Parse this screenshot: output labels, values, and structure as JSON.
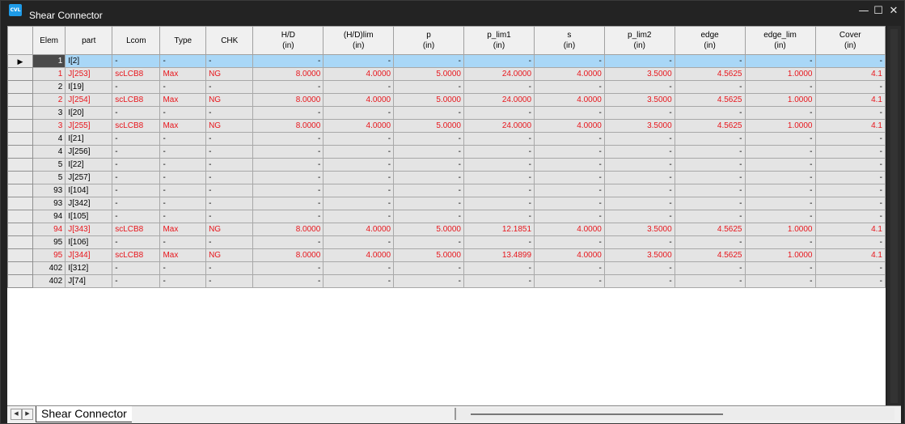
{
  "window": {
    "title": "Shear Connector",
    "icon_text": "CVL"
  },
  "controls": {
    "minimize": "—",
    "maximize": "☐",
    "close": "✕"
  },
  "columns": [
    {
      "line1": "",
      "line2": ""
    },
    {
      "line1": "Elem",
      "line2": ""
    },
    {
      "line1": "part",
      "line2": ""
    },
    {
      "line1": "Lcom",
      "line2": ""
    },
    {
      "line1": "Type",
      "line2": ""
    },
    {
      "line1": "CHK",
      "line2": ""
    },
    {
      "line1": "H/D",
      "line2": "(in)"
    },
    {
      "line1": "(H/D)lim",
      "line2": "(in)"
    },
    {
      "line1": "p",
      "line2": "(in)"
    },
    {
      "line1": "p_lim1",
      "line2": "(in)"
    },
    {
      "line1": "s",
      "line2": "(in)"
    },
    {
      "line1": "p_lim2",
      "line2": "(in)"
    },
    {
      "line1": "edge",
      "line2": "(in)"
    },
    {
      "line1": "edge_lim",
      "line2": "(in)"
    },
    {
      "line1": "Cover",
      "line2": "(in)"
    }
  ],
  "rows": [
    {
      "ind": "▶",
      "ng": false,
      "sel": true,
      "cells": [
        "1",
        "I[2]",
        "-",
        "-",
        "-",
        "-",
        "-",
        "-",
        "-",
        "-",
        "-",
        "-",
        "-",
        "-"
      ]
    },
    {
      "ind": "",
      "ng": true,
      "sel": false,
      "cells": [
        "1",
        "J[253]",
        "scLCB8",
        "Max",
        "NG",
        "8.0000",
        "4.0000",
        "5.0000",
        "24.0000",
        "4.0000",
        "3.5000",
        "4.5625",
        "1.0000",
        "4.1"
      ]
    },
    {
      "ind": "",
      "ng": false,
      "sel": false,
      "cells": [
        "2",
        "I[19]",
        "-",
        "-",
        "-",
        "-",
        "-",
        "-",
        "-",
        "-",
        "-",
        "-",
        "-",
        "-"
      ]
    },
    {
      "ind": "",
      "ng": true,
      "sel": false,
      "cells": [
        "2",
        "J[254]",
        "scLCB8",
        "Max",
        "NG",
        "8.0000",
        "4.0000",
        "5.0000",
        "24.0000",
        "4.0000",
        "3.5000",
        "4.5625",
        "1.0000",
        "4.1"
      ]
    },
    {
      "ind": "",
      "ng": false,
      "sel": false,
      "cells": [
        "3",
        "I[20]",
        "-",
        "-",
        "-",
        "-",
        "-",
        "-",
        "-",
        "-",
        "-",
        "-",
        "-",
        "-"
      ]
    },
    {
      "ind": "",
      "ng": true,
      "sel": false,
      "cells": [
        "3",
        "J[255]",
        "scLCB8",
        "Max",
        "NG",
        "8.0000",
        "4.0000",
        "5.0000",
        "24.0000",
        "4.0000",
        "3.5000",
        "4.5625",
        "1.0000",
        "4.1"
      ]
    },
    {
      "ind": "",
      "ng": false,
      "sel": false,
      "cells": [
        "4",
        "I[21]",
        "-",
        "-",
        "-",
        "-",
        "-",
        "-",
        "-",
        "-",
        "-",
        "-",
        "-",
        "-"
      ]
    },
    {
      "ind": "",
      "ng": false,
      "sel": false,
      "cells": [
        "4",
        "J[256]",
        "-",
        "-",
        "-",
        "-",
        "-",
        "-",
        "-",
        "-",
        "-",
        "-",
        "-",
        "-"
      ]
    },
    {
      "ind": "",
      "ng": false,
      "sel": false,
      "cells": [
        "5",
        "I[22]",
        "-",
        "-",
        "-",
        "-",
        "-",
        "-",
        "-",
        "-",
        "-",
        "-",
        "-",
        "-"
      ]
    },
    {
      "ind": "",
      "ng": false,
      "sel": false,
      "cells": [
        "5",
        "J[257]",
        "-",
        "-",
        "-",
        "-",
        "-",
        "-",
        "-",
        "-",
        "-",
        "-",
        "-",
        "-"
      ]
    },
    {
      "ind": "",
      "ng": false,
      "sel": false,
      "cells": [
        "93",
        "I[104]",
        "-",
        "-",
        "-",
        "-",
        "-",
        "-",
        "-",
        "-",
        "-",
        "-",
        "-",
        "-"
      ]
    },
    {
      "ind": "",
      "ng": false,
      "sel": false,
      "cells": [
        "93",
        "J[342]",
        "-",
        "-",
        "-",
        "-",
        "-",
        "-",
        "-",
        "-",
        "-",
        "-",
        "-",
        "-"
      ]
    },
    {
      "ind": "",
      "ng": false,
      "sel": false,
      "cells": [
        "94",
        "I[105]",
        "-",
        "-",
        "-",
        "-",
        "-",
        "-",
        "-",
        "-",
        "-",
        "-",
        "-",
        "-"
      ]
    },
    {
      "ind": "",
      "ng": true,
      "sel": false,
      "cells": [
        "94",
        "J[343]",
        "scLCB8",
        "Max",
        "NG",
        "8.0000",
        "4.0000",
        "5.0000",
        "12.1851",
        "4.0000",
        "3.5000",
        "4.5625",
        "1.0000",
        "4.1"
      ]
    },
    {
      "ind": "",
      "ng": false,
      "sel": false,
      "cells": [
        "95",
        "I[106]",
        "-",
        "-",
        "-",
        "-",
        "-",
        "-",
        "-",
        "-",
        "-",
        "-",
        "-",
        "-"
      ]
    },
    {
      "ind": "",
      "ng": true,
      "sel": false,
      "cells": [
        "95",
        "J[344]",
        "scLCB8",
        "Max",
        "NG",
        "8.0000",
        "4.0000",
        "5.0000",
        "13.4899",
        "4.0000",
        "3.5000",
        "4.5625",
        "1.0000",
        "4.1"
      ]
    },
    {
      "ind": "",
      "ng": false,
      "sel": false,
      "cells": [
        "402",
        "I[312]",
        "-",
        "-",
        "-",
        "-",
        "-",
        "-",
        "-",
        "-",
        "-",
        "-",
        "-",
        "-"
      ]
    },
    {
      "ind": "",
      "ng": false,
      "sel": false,
      "cells": [
        "402",
        "J[74]",
        "-",
        "-",
        "-",
        "-",
        "-",
        "-",
        "-",
        "-",
        "-",
        "-",
        "-",
        "-"
      ]
    }
  ],
  "sheet_tab": {
    "label": "Shear Connector"
  },
  "nav": {
    "prev": "◀",
    "next": "▶"
  },
  "colors": {
    "ng_text": "#e8161c",
    "selected_row": "#a9d7f7"
  }
}
